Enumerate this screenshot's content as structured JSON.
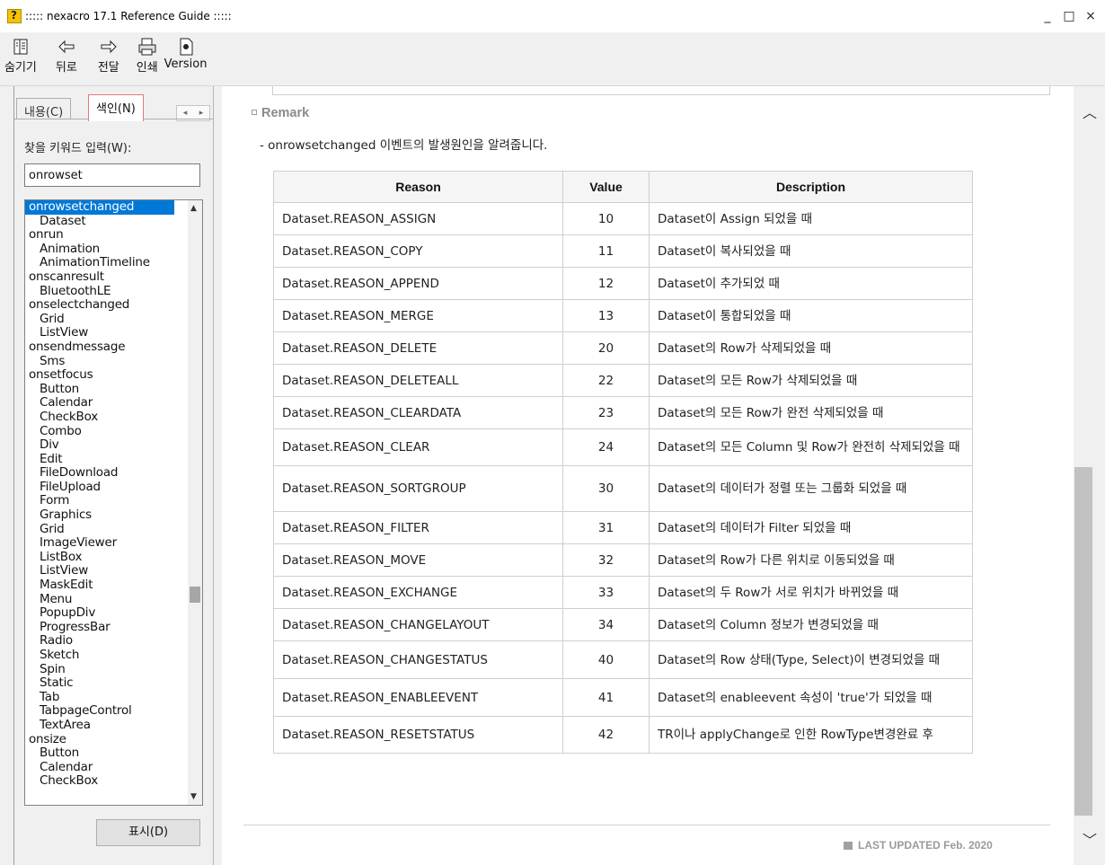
{
  "window": {
    "title": "::::: nexacro 17.1 Reference Guide :::::",
    "controls": [
      "_",
      "□",
      "×"
    ]
  },
  "toolbar": {
    "hide": {
      "label": "숨기기",
      "icon": "hide-icon"
    },
    "back": {
      "label": "뒤로",
      "icon": "back-arrow-icon"
    },
    "forward": {
      "label": "전달",
      "icon": "forward-arrow-icon"
    },
    "print": {
      "label": "인쇄",
      "icon": "print-icon"
    },
    "version": {
      "label": "Version",
      "icon": "version-icon"
    }
  },
  "sidebar": {
    "tabs": [
      "내용(C)",
      "색인(N)"
    ],
    "keyword_label": "찾을 키워드 입력(W):",
    "keyword_value": "onrowset",
    "show_button": "표시(D)",
    "items": [
      {
        "text": "onrowsetchanged",
        "level": 0,
        "selected": true
      },
      {
        "text": "Dataset",
        "level": 1
      },
      {
        "text": "onrun",
        "level": 0
      },
      {
        "text": "Animation",
        "level": 1
      },
      {
        "text": "AnimationTimeline",
        "level": 1
      },
      {
        "text": "onscanresult",
        "level": 0
      },
      {
        "text": "BluetoothLE",
        "level": 1
      },
      {
        "text": "onselectchanged",
        "level": 0
      },
      {
        "text": "Grid",
        "level": 1
      },
      {
        "text": "ListView",
        "level": 1
      },
      {
        "text": "onsendmessage",
        "level": 0
      },
      {
        "text": "Sms",
        "level": 1
      },
      {
        "text": "onsetfocus",
        "level": 0
      },
      {
        "text": "Button",
        "level": 1
      },
      {
        "text": "Calendar",
        "level": 1
      },
      {
        "text": "CheckBox",
        "level": 1
      },
      {
        "text": "Combo",
        "level": 1
      },
      {
        "text": "Div",
        "level": 1
      },
      {
        "text": "Edit",
        "level": 1
      },
      {
        "text": "FileDownload",
        "level": 1
      },
      {
        "text": "FileUpload",
        "level": 1
      },
      {
        "text": "Form",
        "level": 1
      },
      {
        "text": "Graphics",
        "level": 1
      },
      {
        "text": "Grid",
        "level": 1
      },
      {
        "text": "ImageViewer",
        "level": 1
      },
      {
        "text": "ListBox",
        "level": 1
      },
      {
        "text": "ListView",
        "level": 1
      },
      {
        "text": "MaskEdit",
        "level": 1
      },
      {
        "text": "Menu",
        "level": 1
      },
      {
        "text": "PopupDiv",
        "level": 1
      },
      {
        "text": "ProgressBar",
        "level": 1
      },
      {
        "text": "Radio",
        "level": 1
      },
      {
        "text": "Sketch",
        "level": 1
      },
      {
        "text": "Spin",
        "level": 1
      },
      {
        "text": "Static",
        "level": 1
      },
      {
        "text": "Tab",
        "level": 1
      },
      {
        "text": "TabpageControl",
        "level": 1
      },
      {
        "text": "TextArea",
        "level": 1
      },
      {
        "text": "onsize",
        "level": 0
      },
      {
        "text": "Button",
        "level": 1
      },
      {
        "text": "Calendar",
        "level": 1
      },
      {
        "text": "CheckBox",
        "level": 1
      }
    ]
  },
  "content": {
    "remark_title": "Remark",
    "remark_desc": "- onrowsetchanged 이벤트의 발생원인을 알려줍니다.",
    "table_headers": [
      "Reason",
      "Value",
      "Description"
    ],
    "rows": [
      {
        "reason": "Dataset.REASON_ASSIGN",
        "value": "10",
        "desc": "Dataset이 Assign 되었을 때"
      },
      {
        "reason": "Dataset.REASON_COPY",
        "value": "11",
        "desc": "Dataset이 복사되었을 때"
      },
      {
        "reason": "Dataset.REASON_APPEND",
        "value": "12",
        "desc": "Dataset이 추가되었 때"
      },
      {
        "reason": "Dataset.REASON_MERGE",
        "value": "13",
        "desc": "Dataset이 통합되었을 때"
      },
      {
        "reason": "Dataset.REASON_DELETE",
        "value": "20",
        "desc": "Dataset의 Row가 삭제되었을 때"
      },
      {
        "reason": "Dataset.REASON_DELETEALL",
        "value": "22",
        "desc": "Dataset의 모든 Row가 삭제되었을 때"
      },
      {
        "reason": "Dataset.REASON_CLEARDATA",
        "value": "23",
        "desc": "Dataset의 모든 Row가 완전 삭제되었을 때"
      },
      {
        "reason": "Dataset.REASON_CLEAR",
        "value": "24",
        "desc": "Dataset의 모든 Column 및 Row가 완전히 삭제되었을 때"
      },
      {
        "reason": "Dataset.REASON_SORTGROUP",
        "value": "30",
        "desc": "Dataset의 데이터가 정렬 또는 그룹화 되었을 때"
      },
      {
        "reason": "Dataset.REASON_FILTER",
        "value": "31",
        "desc": "Dataset의 데이터가 Filter 되었을 때"
      },
      {
        "reason": "Dataset.REASON_MOVE",
        "value": "32",
        "desc": "Dataset의 Row가 다른 위치로 이동되었을 때"
      },
      {
        "reason": "Dataset.REASON_EXCHANGE",
        "value": "33",
        "desc": "Dataset의 두 Row가 서로 위치가 바뀌었을 때"
      },
      {
        "reason": "Dataset.REASON_CHANGELAYOUT",
        "value": "34",
        "desc": "Dataset의 Column 정보가 변경되었을 때"
      },
      {
        "reason": "Dataset.REASON_CHANGESTATUS",
        "value": "40",
        "desc": "Dataset의 Row 상태(Type, Select)이 변경되었을 때"
      },
      {
        "reason": "Dataset.REASON_ENABLEEVENT",
        "value": "41",
        "desc": "Dataset의 enableevent 속성이 'true'가 되었을 때"
      },
      {
        "reason": "Dataset.REASON_RESETSTATUS",
        "value": "42",
        "desc": "TR이나 applyChange로 인한 RowType변경완료 후"
      }
    ],
    "last_updated": "LAST UPDATED Feb. 2020"
  }
}
